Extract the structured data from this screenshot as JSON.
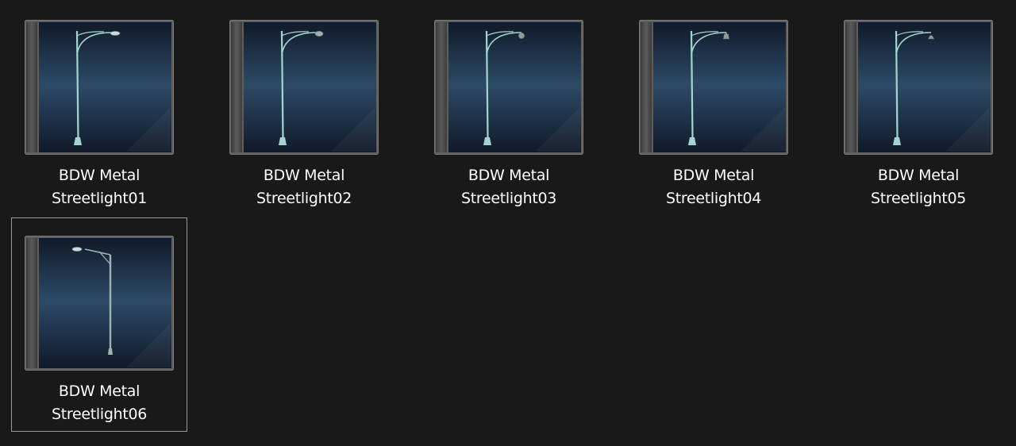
{
  "folder": {
    "items": [
      {
        "line1": "BDW Metal",
        "line2": "Streetlight01",
        "lamp": "cobra",
        "arm": "right",
        "selected": false
      },
      {
        "line1": "BDW Metal",
        "line2": "Streetlight02",
        "lamp": "oval",
        "arm": "right",
        "selected": false
      },
      {
        "line1": "BDW Metal",
        "line2": "Streetlight03",
        "lamp": "acorn",
        "arm": "right",
        "selected": false
      },
      {
        "line1": "BDW Metal",
        "line2": "Streetlight04",
        "lamp": "pendant",
        "arm": "right",
        "selected": false
      },
      {
        "line1": "BDW Metal",
        "line2": "Streetlight05",
        "lamp": "bell",
        "arm": "right",
        "selected": false
      },
      {
        "line1": "BDW Metal",
        "line2": "Streetlight06",
        "lamp": "cobra",
        "arm": "left",
        "selected": true
      }
    ]
  },
  "colors": {
    "background": "#191919",
    "case_frame": "#5e5e5e",
    "case_spine": "#4a4a4a",
    "panel_dark": "#101a2a",
    "panel_mid": "#2d4a66",
    "pole": "#a6d4d2",
    "label_text": "#ffffff",
    "selection_border": "#9a9a9a"
  }
}
